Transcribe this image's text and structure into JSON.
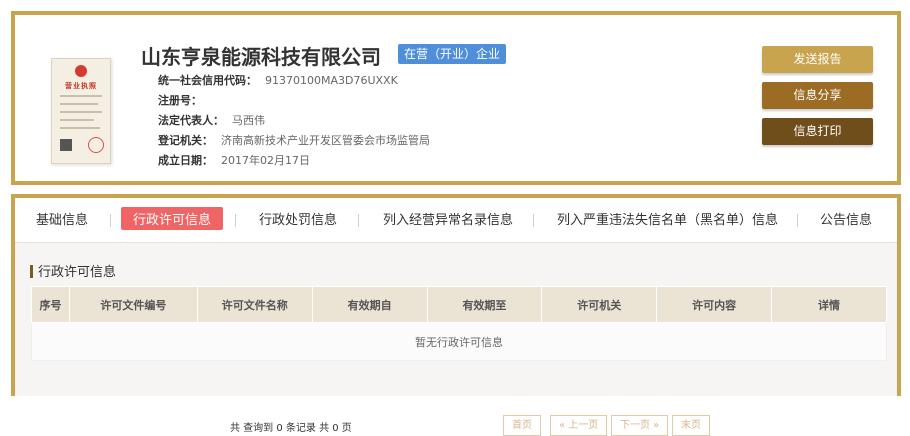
{
  "company": {
    "name": "山东亨泉能源科技有限公司",
    "status": "在营（开业）企业",
    "fields": [
      {
        "label": "统一社会信用代码：",
        "value": "91370100MA3D76UXXK"
      },
      {
        "label": "注册号：",
        "value": ""
      },
      {
        "label": "法定代表人：",
        "value": "马西伟"
      },
      {
        "label": "登记机关：",
        "value": "济南高新技术产业开发区管委会市场监管局"
      },
      {
        "label": "成立日期：",
        "value": "2017年02月17日"
      }
    ]
  },
  "license_image": {
    "title": "营业执照"
  },
  "actions": [
    {
      "label": "发送报告",
      "color": "#c9a44e"
    },
    {
      "label": "信息分享",
      "color": "#9c6c24"
    },
    {
      "label": "信息打印",
      "color": "#6f4e1b"
    }
  ],
  "tabs": [
    "基础信息",
    "行政许可信息",
    "行政处罚信息",
    "列入经营异常名录信息",
    "列入严重违法失信名单（黑名单）信息",
    "公告信息"
  ],
  "active_tab": "行政许可信息",
  "section": {
    "title": "行政许可信息",
    "columns": [
      "序号",
      "许可文件编号",
      "许可文件名称",
      "有效期自",
      "有效期至",
      "许可机关",
      "许可内容",
      "详情"
    ],
    "empty_text": "暂无行政许可信息"
  },
  "pagination": {
    "summary": "共 查询到 0 条记录 共 0 页",
    "first": "首页",
    "prev": "« 上一页",
    "next": "下一页 »",
    "last": "末页"
  },
  "colors": {
    "accent_border": "#c9a44e",
    "active_tab": "#ef6464",
    "status_badge": "#4f8fd9"
  }
}
